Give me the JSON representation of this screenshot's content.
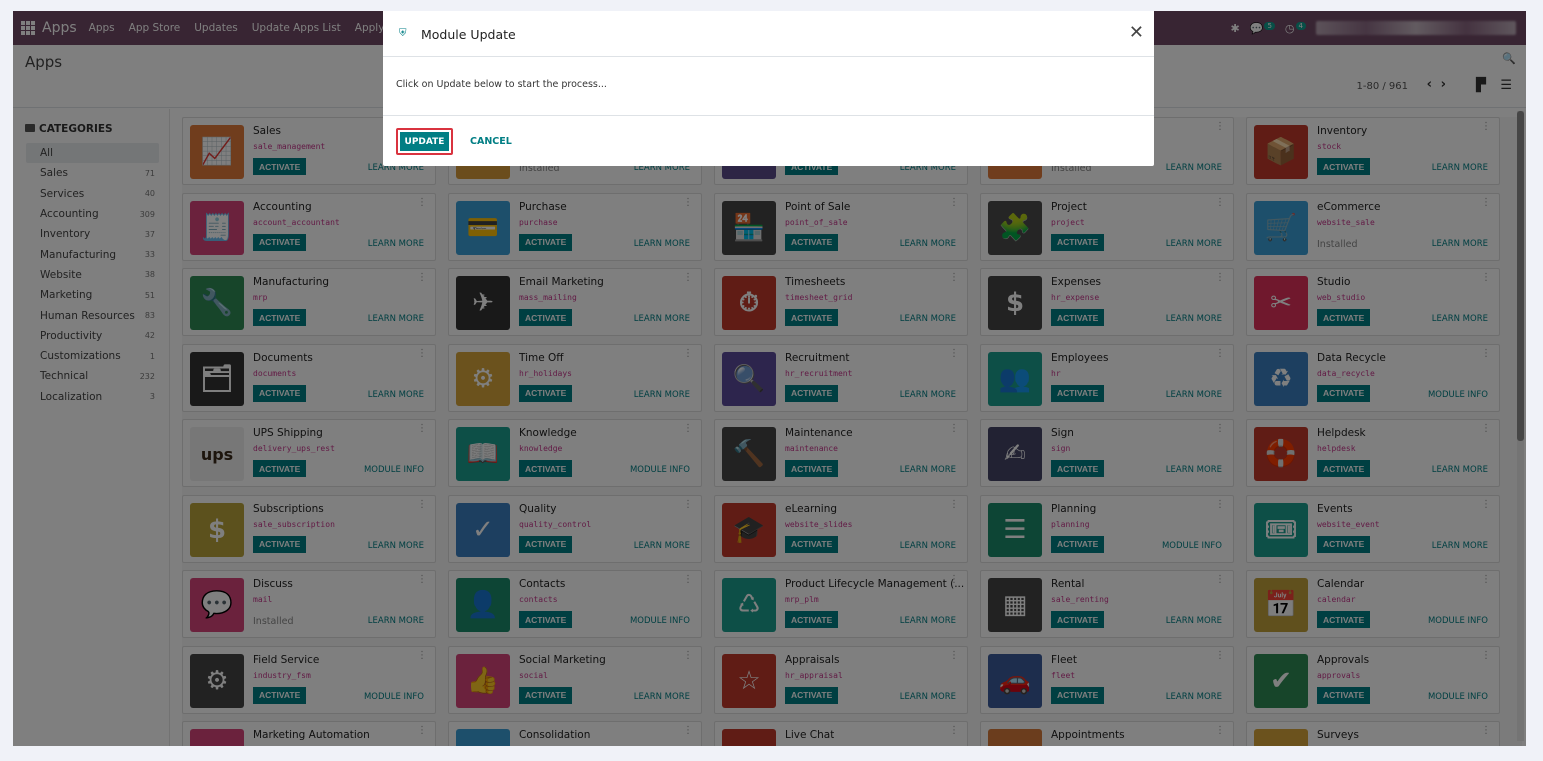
{
  "topnav": {
    "brand": "Apps",
    "menus": [
      "Apps",
      "App Store",
      "Updates",
      "Update Apps List",
      "Apply S"
    ],
    "chat_count": "5",
    "activity_count": "4"
  },
  "control_panel": {
    "breadcrumb": "Apps",
    "pager": "1-80 / 961"
  },
  "sidebar": {
    "title": "CATEGORIES",
    "items": [
      {
        "label": "All",
        "count": ""
      },
      {
        "label": "Sales",
        "count": "71"
      },
      {
        "label": "Services",
        "count": "40"
      },
      {
        "label": "Accounting",
        "count": "309"
      },
      {
        "label": "Inventory",
        "count": "37"
      },
      {
        "label": "Manufacturing",
        "count": "33"
      },
      {
        "label": "Website",
        "count": "38"
      },
      {
        "label": "Marketing",
        "count": "51"
      },
      {
        "label": "Human Resources",
        "count": "83"
      },
      {
        "label": "Productivity",
        "count": "42"
      },
      {
        "label": "Customizations",
        "count": "1"
      },
      {
        "label": "Technical",
        "count": "232"
      },
      {
        "label": "Localization",
        "count": "3"
      }
    ]
  },
  "labels": {
    "activate": "ACTIVATE",
    "installed": "Installed",
    "learn_more": "LEARN MORE",
    "module_info": "MODULE INFO"
  },
  "apps": [
    {
      "name": "Sales",
      "tech": "sale_management",
      "state": "activate",
      "link": "LEARN MORE",
      "color": "#e07a3a",
      "glyph": "📈"
    },
    {
      "name": "",
      "tech": "",
      "state": "installed",
      "link": "LEARN MORE",
      "color": "#d69b3a",
      "glyph": ""
    },
    {
      "name": "",
      "tech": "",
      "state": "activate",
      "link": "LEARN MORE",
      "color": "#5a4a8a",
      "glyph": ""
    },
    {
      "name": "",
      "tech": "",
      "state": "installed",
      "link": "LEARN MORE",
      "color": "#e07a3a",
      "glyph": ""
    },
    {
      "name": "Inventory",
      "tech": "stock",
      "state": "activate",
      "link": "LEARN MORE",
      "color": "#c0392b",
      "glyph": "📦"
    },
    {
      "name": "Accounting",
      "tech": "account_accountant",
      "state": "activate",
      "link": "LEARN MORE",
      "color": "#d6447a",
      "glyph": "🧾"
    },
    {
      "name": "Purchase",
      "tech": "purchase",
      "state": "activate",
      "link": "LEARN MORE",
      "color": "#3a9ed6",
      "glyph": "💳"
    },
    {
      "name": "Point of Sale",
      "tech": "point_of_sale",
      "state": "activate",
      "link": "LEARN MORE",
      "color": "#444444",
      "glyph": "🏪"
    },
    {
      "name": "Project",
      "tech": "project",
      "state": "activate",
      "link": "LEARN MORE",
      "color": "#4a4a4a",
      "glyph": "🧩"
    },
    {
      "name": "eCommerce",
      "tech": "website_sale",
      "state": "installed",
      "link": "LEARN MORE",
      "color": "#3a9ed6",
      "glyph": "🛒"
    },
    {
      "name": "Manufacturing",
      "tech": "mrp",
      "state": "activate",
      "link": "LEARN MORE",
      "color": "#2f8a55",
      "glyph": "🔧"
    },
    {
      "name": "Email Marketing",
      "tech": "mass_mailing",
      "state": "activate",
      "link": "LEARN MORE",
      "color": "#333333",
      "glyph": "✈"
    },
    {
      "name": "Timesheets",
      "tech": "timesheet_grid",
      "state": "activate",
      "link": "LEARN MORE",
      "color": "#c0392b",
      "glyph": "⏱"
    },
    {
      "name": "Expenses",
      "tech": "hr_expense",
      "state": "activate",
      "link": "LEARN MORE",
      "color": "#444444",
      "glyph": "$"
    },
    {
      "name": "Studio",
      "tech": "web_studio",
      "state": "activate",
      "link": "LEARN MORE",
      "color": "#e0315a",
      "glyph": "✂"
    },
    {
      "name": "Documents",
      "tech": "documents",
      "state": "activate",
      "link": "LEARN MORE",
      "color": "#333333",
      "glyph": "🗂"
    },
    {
      "name": "Time Off",
      "tech": "hr_holidays",
      "state": "activate",
      "link": "LEARN MORE",
      "color": "#d6a53a",
      "glyph": "⚙"
    },
    {
      "name": "Recruitment",
      "tech": "hr_recruitment",
      "state": "activate",
      "link": "LEARN MORE",
      "color": "#5a4a9a",
      "glyph": "🔍"
    },
    {
      "name": "Employees",
      "tech": "hr",
      "state": "activate",
      "link": "LEARN MORE",
      "color": "#1a9e8f",
      "glyph": "👥"
    },
    {
      "name": "Data Recycle",
      "tech": "data_recycle",
      "state": "activate",
      "link": "MODULE INFO",
      "color": "#3a7ec0",
      "glyph": "♻"
    },
    {
      "name": "UPS Shipping",
      "tech": "delivery_ups_rest",
      "state": "activate",
      "link": "MODULE INFO",
      "color": "#eeeeee",
      "glyph": "ups"
    },
    {
      "name": "Knowledge",
      "tech": "knowledge",
      "state": "activate",
      "link": "MODULE INFO",
      "color": "#1a9e8f",
      "glyph": "📖"
    },
    {
      "name": "Maintenance",
      "tech": "maintenance",
      "state": "activate",
      "link": "LEARN MORE",
      "color": "#444444",
      "glyph": "🔨"
    },
    {
      "name": "Sign",
      "tech": "sign",
      "state": "activate",
      "link": "LEARN MORE",
      "color": "#444466",
      "glyph": "✍"
    },
    {
      "name": "Helpdesk",
      "tech": "helpdesk",
      "state": "activate",
      "link": "LEARN MORE",
      "color": "#c0392b",
      "glyph": "🛟"
    },
    {
      "name": "Subscriptions",
      "tech": "sale_subscription",
      "state": "activate",
      "link": "LEARN MORE",
      "color": "#b8a23a",
      "glyph": "$"
    },
    {
      "name": "Quality",
      "tech": "quality_control",
      "state": "activate",
      "link": "LEARN MORE",
      "color": "#3a7ec0",
      "glyph": "✓"
    },
    {
      "name": "eLearning",
      "tech": "website_slides",
      "state": "activate",
      "link": "LEARN MORE",
      "color": "#c0392b",
      "glyph": "🎓"
    },
    {
      "name": "Planning",
      "tech": "planning",
      "state": "activate",
      "link": "MODULE INFO",
      "color": "#1a8a6a",
      "glyph": "☰"
    },
    {
      "name": "Events",
      "tech": "website_event",
      "state": "activate",
      "link": "LEARN MORE",
      "color": "#1a9e8f",
      "glyph": "🎟"
    },
    {
      "name": "Discuss",
      "tech": "mail",
      "state": "installed",
      "link": "LEARN MORE",
      "color": "#d6447a",
      "glyph": "💬"
    },
    {
      "name": "Contacts",
      "tech": "contacts",
      "state": "activate",
      "link": "MODULE INFO",
      "color": "#1a8a6a",
      "glyph": "👤"
    },
    {
      "name": "Product Lifecycle Management (...",
      "tech": "mrp_plm",
      "state": "activate",
      "link": "LEARN MORE",
      "color": "#1a9e8f",
      "glyph": "♺"
    },
    {
      "name": "Rental",
      "tech": "sale_renting",
      "state": "activate",
      "link": "LEARN MORE",
      "color": "#444444",
      "glyph": "▦"
    },
    {
      "name": "Calendar",
      "tech": "calendar",
      "state": "activate",
      "link": "MODULE INFO",
      "color": "#c0a03a",
      "glyph": "📅"
    },
    {
      "name": "Field Service",
      "tech": "industry_fsm",
      "state": "activate",
      "link": "MODULE INFO",
      "color": "#444444",
      "glyph": "⚙"
    },
    {
      "name": "Social Marketing",
      "tech": "social",
      "state": "activate",
      "link": "LEARN MORE",
      "color": "#d6447a",
      "glyph": "👍"
    },
    {
      "name": "Appraisals",
      "tech": "hr_appraisal",
      "state": "activate",
      "link": "LEARN MORE",
      "color": "#c0392b",
      "glyph": "☆"
    },
    {
      "name": "Fleet",
      "tech": "fleet",
      "state": "activate",
      "link": "LEARN MORE",
      "color": "#3a5a9a",
      "glyph": "🚗"
    },
    {
      "name": "Approvals",
      "tech": "approvals",
      "state": "activate",
      "link": "MODULE INFO",
      "color": "#2f8a55",
      "glyph": "✔"
    },
    {
      "name": "Marketing Automation",
      "tech": "",
      "state": "none",
      "link": "",
      "color": "#d6447a",
      "glyph": ""
    },
    {
      "name": "Consolidation",
      "tech": "",
      "state": "none",
      "link": "",
      "color": "#3a9ed6",
      "glyph": ""
    },
    {
      "name": "Live Chat",
      "tech": "",
      "state": "none",
      "link": "",
      "color": "#c0392b",
      "glyph": ""
    },
    {
      "name": "Appointments",
      "tech": "",
      "state": "none",
      "link": "",
      "color": "#d67a3a",
      "glyph": ""
    },
    {
      "name": "Surveys",
      "tech": "",
      "state": "none",
      "link": "",
      "color": "#d6a53a",
      "glyph": ""
    }
  ],
  "dialog": {
    "title": "Module Update",
    "message": "Click on Update below to start the process...",
    "update_label": "UPDATE",
    "cancel_label": "CANCEL"
  }
}
